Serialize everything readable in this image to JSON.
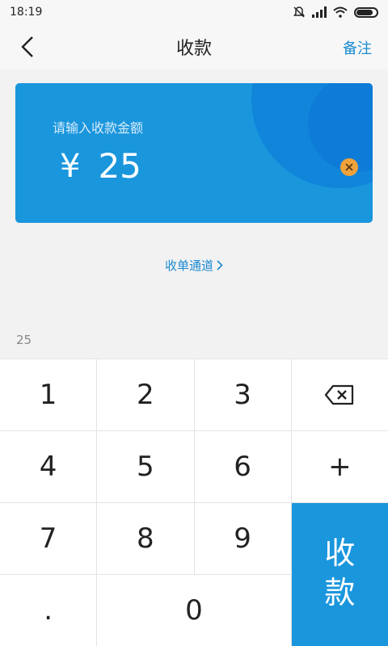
{
  "status_bar": {
    "time": "18:19",
    "battery_level": 0.85
  },
  "nav": {
    "title": "收款",
    "note_label": "备注"
  },
  "card": {
    "label": "请输入收款金额",
    "currency": "¥",
    "amount": "25"
  },
  "channel": {
    "label": "收单通道"
  },
  "expression": "25",
  "keypad": {
    "k1": "1",
    "k2": "2",
    "k3": "3",
    "k4": "4",
    "k5": "5",
    "k6": "6",
    "plus": "+",
    "k7": "7",
    "k8": "8",
    "k9": "9",
    "dot": ".",
    "k0": "0",
    "submit_1": "收",
    "submit_2": "款"
  },
  "colors": {
    "accent": "#1a96dd",
    "link": "#1a8ad2",
    "clear": "#f0a23b"
  }
}
